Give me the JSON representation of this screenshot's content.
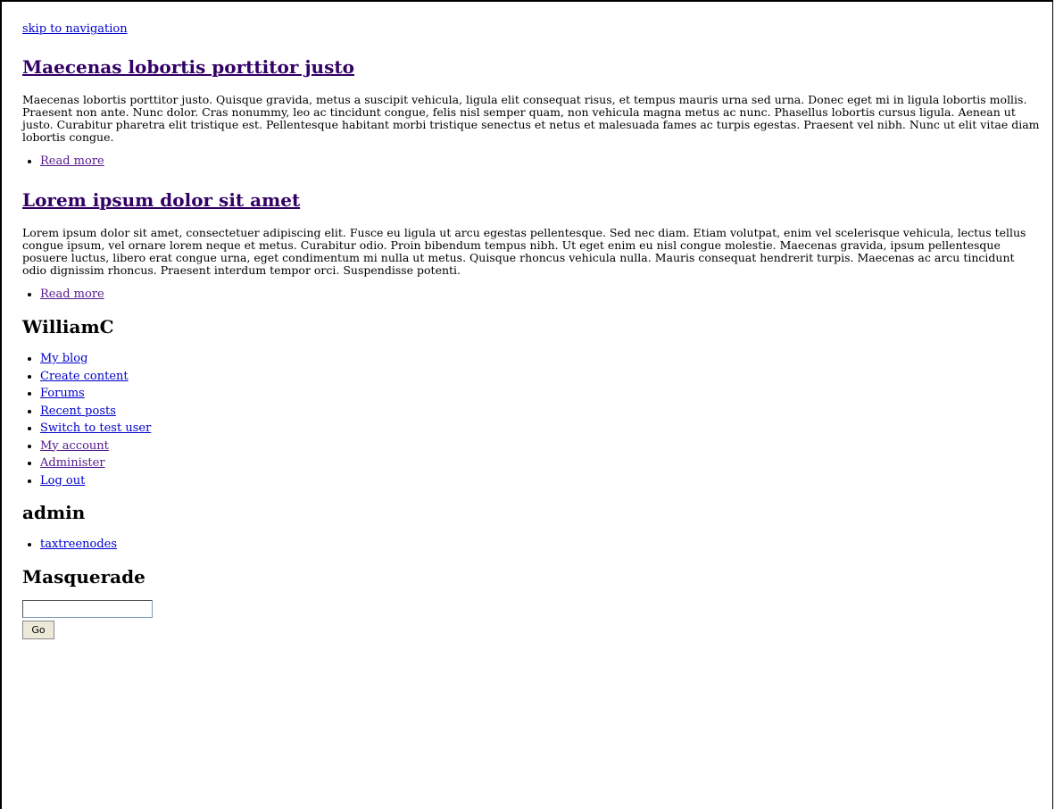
{
  "skip_link": "skip to navigation",
  "nodes": [
    {
      "title": "Maecenas lobortis porttitor justo",
      "body": "Maecenas lobortis porttitor justo. Quisque gravida, metus a suscipit vehicula, ligula elit consequat risus, et tempus mauris urna sed urna. Donec eget mi in ligula lobortis mollis. Praesent non ante. Nunc dolor. Cras nonummy, leo ac tincidunt congue, felis nisl semper quam, non vehicula magna metus ac nunc. Phasellus lobortis cursus ligula. Aenean ut justo. Curabitur pharetra elit tristique est. Pellentesque habitant morbi tristique senectus et netus et malesuada fames ac turpis egestas. Praesent vel nibh. Nunc ut elit vitae diam lobortis congue.",
      "read_more": "Read more"
    },
    {
      "title": "Lorem ipsum dolor sit amet",
      "body": "Lorem ipsum dolor sit amet, consectetuer adipiscing elit. Fusce eu ligula ut arcu egestas pellentesque. Sed nec diam. Etiam volutpat, enim vel scelerisque vehicula, lectus tellus congue ipsum, vel ornare lorem neque et metus. Curabitur odio. Proin bibendum tempus nibh. Ut eget enim eu nisl congue molestie. Maecenas gravida, ipsum pellentesque posuere luctus, libero erat congue urna, eget condimentum mi nulla ut metus. Quisque rhoncus vehicula nulla. Mauris consequat hendrerit turpis. Maecenas ac arcu tincidunt odio dignissim rhoncus. Praesent interdum tempor orci. Suspendisse potenti.",
      "read_more": "Read more"
    }
  ],
  "user_block": {
    "title": "WilliamC",
    "items": [
      {
        "label": "My blog"
      },
      {
        "label": "Create content"
      },
      {
        "label": "Forums"
      },
      {
        "label": "Recent posts"
      },
      {
        "label": "Switch to test user"
      },
      {
        "label": "My account"
      },
      {
        "label": "Administer"
      },
      {
        "label": "Log out"
      }
    ]
  },
  "admin_block": {
    "title": "admin",
    "items": [
      {
        "label": "taxtreenodes"
      }
    ]
  },
  "masquerade_block": {
    "title": "Masquerade",
    "input_value": "",
    "button_label": "Go"
  },
  "colors": {
    "link": "#0000cc",
    "visited": "#551a8b",
    "title_link": "#330066"
  }
}
